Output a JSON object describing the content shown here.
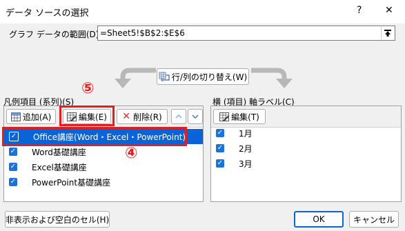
{
  "window": {
    "title": "データ ソースの選択",
    "help_label": "?",
    "close_label": "✕"
  },
  "range": {
    "label": "グラフ データの範囲(D):",
    "value": "=Sheet5!$B$2:$E$6"
  },
  "switch_button": {
    "label": "行/列の切り替え(W)"
  },
  "legend": {
    "label": "凡例項目 (系列)(S)",
    "add_label": "追加(A)",
    "edit_label": "編集(E)",
    "delete_label": "削除(R)",
    "items": [
      {
        "label": "Office講座(Word・Excel・PowerPoint)",
        "checked": true,
        "selected": true
      },
      {
        "label": "Word基礎講座",
        "checked": true,
        "selected": false
      },
      {
        "label": "Excel基礎講座",
        "checked": true,
        "selected": false
      },
      {
        "label": "PowerPoint基礎講座",
        "checked": true,
        "selected": false
      }
    ]
  },
  "axis": {
    "label": "横 (項目) 軸ラベル(C)",
    "edit_label": "編集(T)",
    "items": [
      {
        "label": "1月",
        "checked": true
      },
      {
        "label": "2月",
        "checked": true
      },
      {
        "label": "3月",
        "checked": true
      }
    ]
  },
  "annotations": {
    "step_edit": "⑤",
    "step_select": "④"
  },
  "footer": {
    "hidden_cells_label": "非表示および空白のセル(H)",
    "ok_label": "OK",
    "cancel_label": "キャンセル"
  },
  "colors": {
    "selection": "#0a64d6",
    "highlight_box": "#e41d1d",
    "checkbox": "#1a73d9"
  }
}
